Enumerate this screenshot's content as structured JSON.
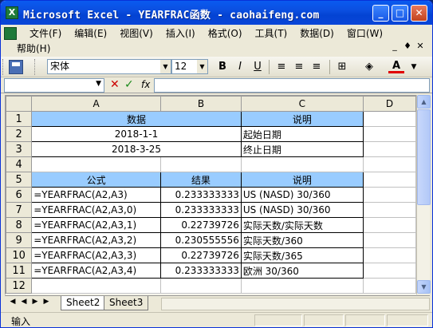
{
  "window": {
    "title": "Microsoft Excel - YEARFRAC函数 - caohaifeng.com",
    "icon_label": "X"
  },
  "title_buttons": {
    "minimize": "_",
    "maximize": "□",
    "close": "✕"
  },
  "menu": {
    "items": [
      "文件(F)",
      "编辑(E)",
      "视图(V)",
      "插入(I)",
      "格式(O)",
      "工具(T)",
      "数据(D)",
      "窗口(W)"
    ],
    "help": "帮助(H)",
    "right_controls": [
      "_",
      "♦",
      "✕"
    ]
  },
  "toolbar": {
    "font_name": "宋体",
    "font_size": "12",
    "bold": "B",
    "italic": "I",
    "underline": "U",
    "font_color_label": "A"
  },
  "formula_bar": {
    "fx": "fx",
    "cancel": "✕",
    "enter": "✓"
  },
  "sheet": {
    "columns": [
      "A",
      "B",
      "C",
      "D"
    ],
    "rows": [
      {
        "n": "1",
        "a": "数据",
        "b": "",
        "c": "说明",
        "a_merge": true
      },
      {
        "n": "2",
        "a": "2018-1-1",
        "b": "",
        "c": "起始日期",
        "a_merge": true
      },
      {
        "n": "3",
        "a": "2018-3-25",
        "b": "",
        "c": "终止日期",
        "a_merge": true
      },
      {
        "n": "4",
        "a": "",
        "b": "",
        "c": ""
      },
      {
        "n": "5",
        "a": "公式",
        "b": "结果",
        "c": "说明"
      },
      {
        "n": "6",
        "a": "=YEARFRAC(A2,A3)",
        "b": "0.233333333",
        "c": "US (NASD) 30/360"
      },
      {
        "n": "7",
        "a": "=YEARFRAC(A2,A3,0)",
        "b": "0.233333333",
        "c": "US (NASD) 30/360"
      },
      {
        "n": "8",
        "a": "=YEARFRAC(A2,A3,1)",
        "b": "0.22739726",
        "c": "实际天数/实际天数"
      },
      {
        "n": "9",
        "a": "=YEARFRAC(A2,A3,2)",
        "b": "0.230555556",
        "c": "实际天数/360"
      },
      {
        "n": "10",
        "a": "=YEARFRAC(A2,A3,3)",
        "b": "0.22739726",
        "c": "实际天数/365"
      },
      {
        "n": "11",
        "a": "=YEARFRAC(A2,A3,4)",
        "b": "0.233333333",
        "c": "欧洲 30/360"
      },
      {
        "n": "12",
        "a": "",
        "b": "",
        "c": ""
      }
    ]
  },
  "tabs": {
    "nav": [
      "◀",
      "◀",
      "▶",
      "▶"
    ],
    "sheets": [
      "Sheet2",
      "Sheet3"
    ]
  },
  "status": {
    "mode": "输入"
  }
}
